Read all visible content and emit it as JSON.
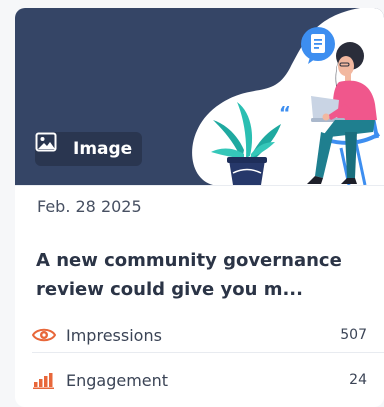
{
  "card": {
    "media_badge": {
      "label": "Image",
      "icon": "image-icon"
    },
    "date": "Feb. 28 2025",
    "title": "A new community governance review could give you m...",
    "metrics": [
      {
        "label": "Impressions",
        "value": "507",
        "icon": "eye-icon",
        "color": "#e8673a"
      },
      {
        "label": "Engagement",
        "value": "24",
        "icon": "bar-chart-icon",
        "color": "#e8673a"
      }
    ]
  },
  "colors": {
    "hero_background": "#354566",
    "accent": "#e8673a",
    "doc_bubble": "#3d8ef0"
  }
}
